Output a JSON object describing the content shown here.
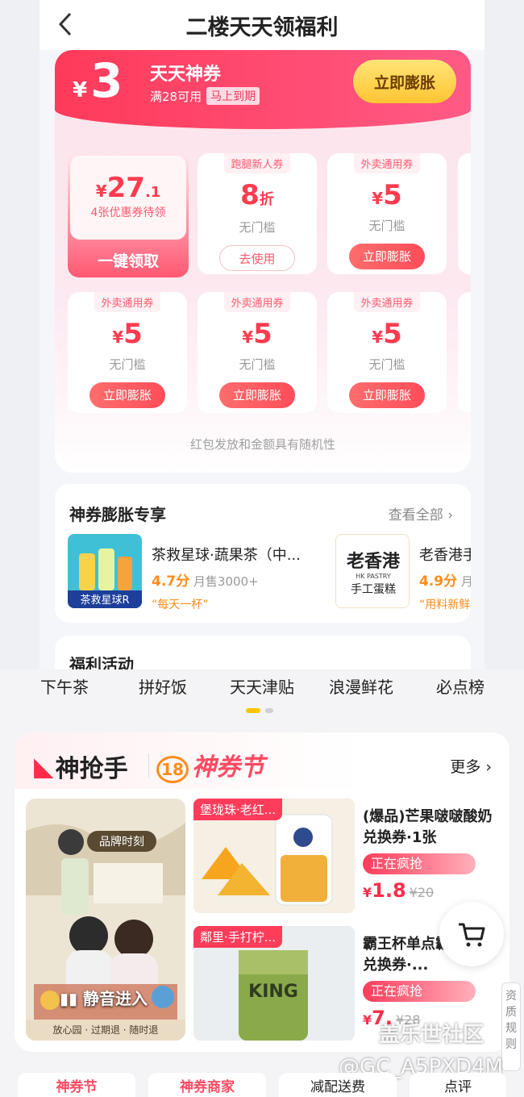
{
  "header": {
    "title": "二楼天天领福利"
  },
  "banner": {
    "currency": "¥",
    "amount": "3",
    "title": "天天神券",
    "condition": "满28可用",
    "tag": "马上到期",
    "button": "立即膨胀"
  },
  "total_coupon": {
    "currency": "¥",
    "amount": "27",
    "decimal": ".1",
    "desc": "4张优惠券待领",
    "button": "一键领取"
  },
  "coupons": [
    {
      "head": "跑腿新人券",
      "value": "8",
      "unit": "折",
      "sub": "无门槛",
      "button": "去使用"
    },
    {
      "head": "外卖通用券",
      "currency": "¥",
      "value": "5",
      "sub": "无门槛",
      "button": "立即膨胀"
    },
    {
      "head": "外卖通用券",
      "currency": "¥",
      "value": "5",
      "sub": "无门槛",
      "button": "立即膨胀"
    },
    {
      "head": "外卖通用券",
      "currency": "¥",
      "value": "5",
      "sub": "无门槛",
      "button": "立即膨胀"
    },
    {
      "head": "外卖通用券",
      "currency": "¥",
      "value": "5",
      "sub": "无门槛",
      "button": "立即膨胀"
    }
  ],
  "coupon_footer": "红包发放和金额具有随机性",
  "expand": {
    "title": "神券膨胀专享",
    "more": "查看全部 ›",
    "shops": [
      {
        "name": "茶救星球·蔬果茶（中...",
        "score": "4.7分",
        "sales": "月售3000+",
        "tag": "“每天一杯”",
        "thumb_text": "茶救星球R"
      },
      {
        "name": "老香港手",
        "score": "4.9分",
        "sales": "月",
        "tag": "“用料新鲜",
        "thumb_text": "老香港",
        "thumb_sub": "HK PASTRY",
        "thumb_sub2": "手工蛋糕"
      }
    ]
  },
  "fuli": {
    "title": "福利活动"
  },
  "categories": [
    "下午茶",
    "拼好饭",
    "天天津贴",
    "浪漫鲜花",
    "必点榜"
  ],
  "shenqiang": {
    "logo": "神抢手",
    "logo2_num": "18",
    "logo2": "神券节",
    "more": "更多 ›",
    "live_label": "静音进入",
    "live_badge": "品牌时刻",
    "live_foot": "放心园 · 过期退 · 随时退",
    "products": [
      {
        "tag": "堡珑珠·老红...",
        "name": "(爆品)芒果啵啵酸奶兑换券·1张",
        "status": "正在疯抢",
        "currency": "¥",
        "price": "1.8",
        "orig": "¥20"
      },
      {
        "tag": "鄰里·手打柠...",
        "name": "霸王杯单点霸王杯）兑换券·...",
        "status": "正在疯抢",
        "currency": "¥",
        "price": "7.",
        "orig": "¥28"
      }
    ]
  },
  "side": {
    "qualification": "资质规则"
  },
  "watermark": {
    "line1": "盖乐世社区",
    "line2": "@GC_A5PXD4M"
  },
  "bottom_nav": [
    "神券节",
    "神券商家",
    "减配送费",
    "点评"
  ],
  "colors": {
    "accent": "#ff3c5a",
    "gold": "#ffc534",
    "orange": "#ff8c1a"
  }
}
